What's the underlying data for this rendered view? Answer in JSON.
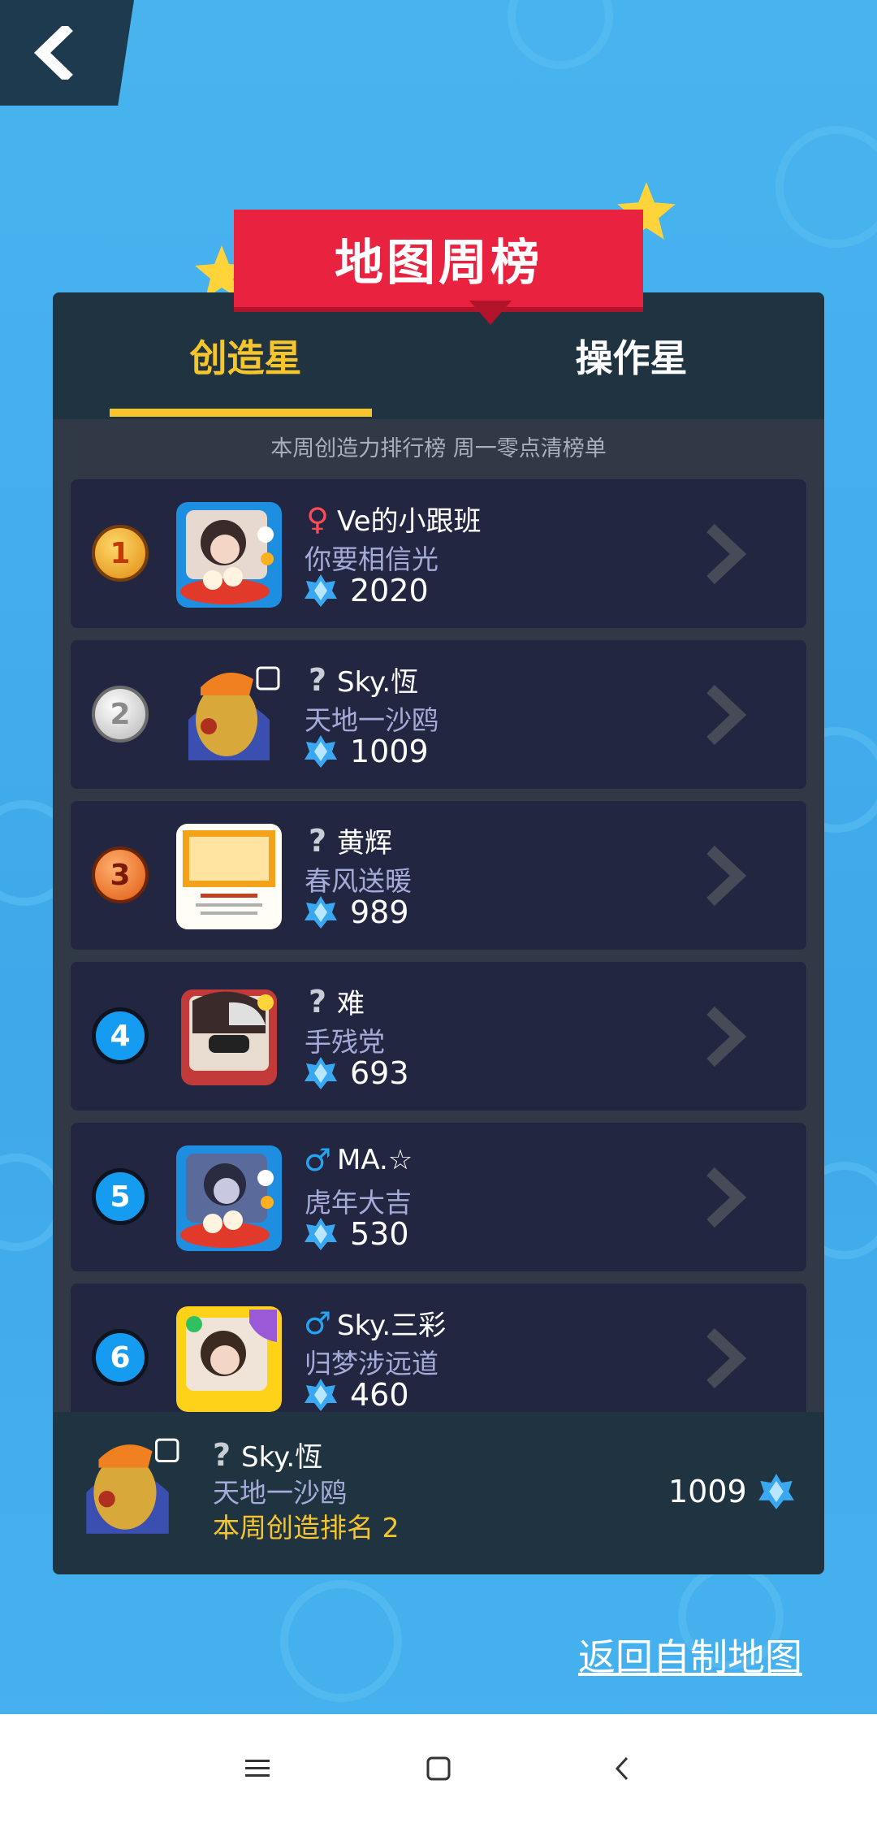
{
  "header": {
    "back_icon": "chevron-left-icon",
    "banner_title": "地图周榜"
  },
  "tabs": [
    {
      "label": "创造星",
      "active": true
    },
    {
      "label": "操作星",
      "active": false
    }
  ],
  "subtitle": "本周创造力排行榜 周一零点清榜单",
  "rows": [
    {
      "rank": "1",
      "medal": "gold",
      "gender": "♀",
      "name": "Ve的小跟班",
      "motto": "你要相信光",
      "score": "2020"
    },
    {
      "rank": "2",
      "medal": "silver",
      "gender": "?",
      "name": "Sky.恆",
      "motto": "天地一沙鸥",
      "score": "1009"
    },
    {
      "rank": "3",
      "medal": "bronze",
      "gender": "?",
      "name": "黄辉",
      "motto": "春风送暖",
      "score": "989"
    },
    {
      "rank": "4",
      "medal": "blue",
      "gender": "?",
      "name": "难",
      "motto": "手残党",
      "score": "693"
    },
    {
      "rank": "5",
      "medal": "blue",
      "gender": "♂",
      "name": "MA.☆",
      "motto": "虎年大吉",
      "score": "530"
    },
    {
      "rank": "6",
      "medal": "blue",
      "gender": "♂",
      "name": "Sky.三彩",
      "motto": "归梦涉远道",
      "score": "460"
    }
  ],
  "my_rank": {
    "gender": "?",
    "name": "Sky.恆",
    "motto": "天地一沙鸥",
    "rank_text": "本周创造排名 2",
    "score": "1009"
  },
  "return_link": "返回自制地图",
  "colors": {
    "background": "#42aeec",
    "panel": "#303945",
    "row": "#232640",
    "accent_yellow": "#f6c52c",
    "banner_red": "#e8223f"
  }
}
